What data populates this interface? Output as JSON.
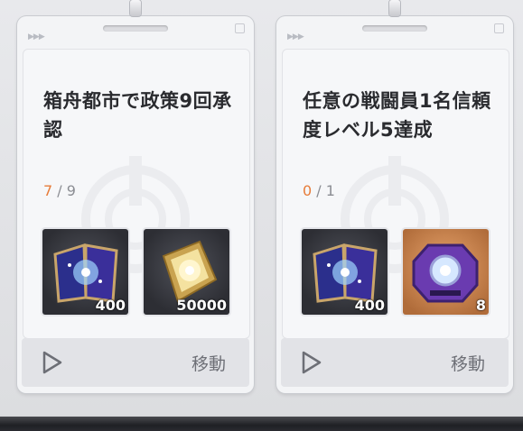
{
  "cards": [
    {
      "title": "箱舟都市で政策9回承認",
      "progress_current": "7",
      "progress_sep": " / ",
      "progress_total": "9",
      "rewards": [
        {
          "icon": "star-book-icon",
          "qty": "400"
        },
        {
          "icon": "gold-ingot-icon",
          "qty": "50000"
        }
      ],
      "button_label": "移動"
    },
    {
      "title": "任意の戦闘員1名信頼度レベル5達成",
      "progress_current": "0",
      "progress_sep": " / ",
      "progress_total": "1",
      "rewards": [
        {
          "icon": "star-book-icon",
          "qty": "400"
        },
        {
          "icon": "purple-device-icon",
          "qty": "8"
        }
      ],
      "button_label": "移動"
    }
  ],
  "colors": {
    "progress_current": "#e77c3a",
    "card_bg": "#f3f4f6",
    "button_bar": "#e2e3e7"
  }
}
